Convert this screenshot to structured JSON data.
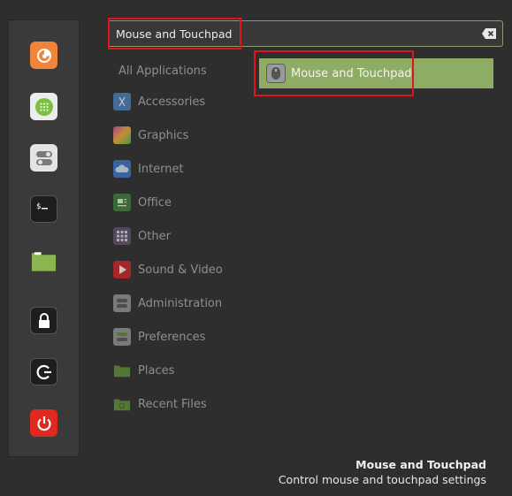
{
  "search": {
    "value": "Mouse and Touchpad",
    "placeholder": "",
    "clear_icon": "backspace-clear-icon"
  },
  "favorites": [
    {
      "name": "Firefox",
      "icon": "firefox-icon",
      "color": "#f0853a"
    },
    {
      "name": "Software Manager",
      "icon": "software-manager-icon",
      "color": "#7cc142"
    },
    {
      "name": "System Settings",
      "icon": "settings-toggle-icon",
      "color": "#e4e4e4"
    },
    {
      "name": "Terminal",
      "icon": "terminal-icon",
      "color": "#1e1e1e"
    },
    {
      "name": "Files",
      "icon": "folder-icon",
      "color": "#8ab550"
    },
    {
      "name": "Lock Screen",
      "icon": "lock-icon",
      "color": "#1e1e1e"
    },
    {
      "name": "Log Out",
      "icon": "logout-icon",
      "color": "#1e1e1e"
    },
    {
      "name": "Quit",
      "icon": "power-icon",
      "color": "#e0281e"
    }
  ],
  "categories": {
    "all_label": "All Applications",
    "items": [
      {
        "label": "Accessories",
        "icon": "scissors-icon",
        "color": "#4a7ab0"
      },
      {
        "label": "Graphics",
        "icon": "color-palette-icon",
        "color": "#c04c9c"
      },
      {
        "label": "Internet",
        "icon": "cloud-icon",
        "color": "#3d6fb8"
      },
      {
        "label": "Office",
        "icon": "document-icon",
        "color": "#3c7a3a"
      },
      {
        "label": "Other",
        "icon": "grid-icon",
        "color": "#5e4f6a"
      },
      {
        "label": "Sound & Video",
        "icon": "play-icon",
        "color": "#c4262a"
      },
      {
        "label": "Administration",
        "icon": "toggle-icon",
        "color": "#8e8e8e"
      },
      {
        "label": "Preferences",
        "icon": "toggle-green-icon",
        "color": "#8e8e8e"
      },
      {
        "label": "Places",
        "icon": "folder-icon",
        "color": "#5e8a3a"
      },
      {
        "label": "Recent Files",
        "icon": "recent-folder-icon",
        "color": "#5e8a3a"
      }
    ]
  },
  "results": [
    {
      "label": "Mouse and Touchpad",
      "icon": "mouse-icon"
    }
  ],
  "info": {
    "title": "Mouse and Touchpad",
    "description": "Control mouse and touchpad settings"
  },
  "colors": {
    "accent": "#8fac65",
    "annotation": "#e0141c"
  }
}
